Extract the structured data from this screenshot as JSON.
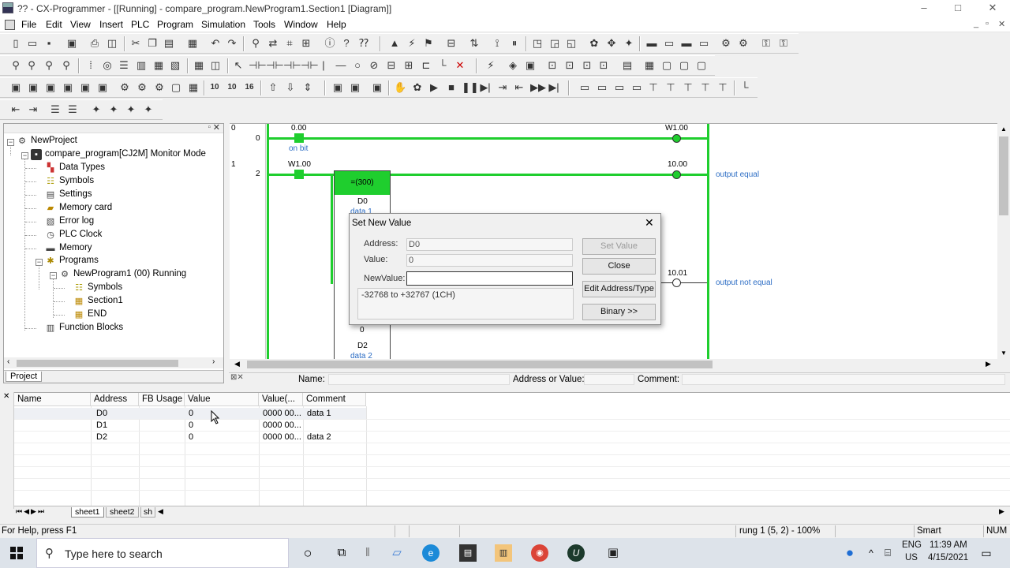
{
  "window": {
    "title": "?? - CX-Programmer - [[Running] - compare_program.NewProgram1.Section1 [Diagram]]",
    "min": "–",
    "max": "□",
    "close": "✕"
  },
  "menu": [
    "File",
    "Edit",
    "View",
    "Insert",
    "PLC",
    "Program",
    "Simulation",
    "Tools",
    "Window",
    "Help"
  ],
  "mdi_buttons": [
    "_",
    "▫",
    "✕"
  ],
  "project_tree": {
    "tab_label": "Project",
    "items": [
      {
        "label": "NewProject",
        "icon": "project-icon"
      },
      {
        "label": "compare_program[CJ2M] Monitor Mode",
        "icon": "plc-icon"
      },
      {
        "label": "Data Types",
        "icon": "data-types-icon"
      },
      {
        "label": "Symbols",
        "icon": "symbols-icon"
      },
      {
        "label": "Settings",
        "icon": "settings-icon"
      },
      {
        "label": "Memory card",
        "icon": "memory-card-icon"
      },
      {
        "label": "Error log",
        "icon": "error-log-icon"
      },
      {
        "label": "PLC Clock",
        "icon": "clock-icon"
      },
      {
        "label": "Memory",
        "icon": "memory-icon"
      },
      {
        "label": "Programs",
        "icon": "programs-icon"
      },
      {
        "label": "NewProgram1 (00) Running",
        "icon": "program-icon"
      },
      {
        "label": "Symbols",
        "icon": "symbols-icon"
      },
      {
        "label": "Section1",
        "icon": "section-icon"
      },
      {
        "label": "END",
        "icon": "section-icon"
      },
      {
        "label": "Function Blocks",
        "icon": "function-blocks-icon"
      }
    ]
  },
  "ladder": {
    "rung0": {
      "number": "0",
      "step": "0",
      "contact_addr": "0.00",
      "contact_comment": "on bit",
      "coil_addr": "W1.00"
    },
    "rung1": {
      "number": "1",
      "step": "2",
      "contact_addr": "W1.00",
      "block_label": "=(300)",
      "operand1": "D0",
      "operand1_comment": "data 1",
      "operand2_value": "0",
      "operand2": "D2",
      "operand2_comment": "data 2",
      "coil1_addr": "10.00",
      "coil1_comment": "output equal",
      "coil2_addr": "10.01",
      "coil2_comment": "output not equal"
    },
    "bottom_bar": {
      "name_label": "Name:",
      "address_label": "Address or Value:",
      "comment_label": "Comment:"
    }
  },
  "dialog": {
    "title": "Set New Value",
    "address_label": "Address:",
    "address_value": "D0",
    "value_label": "Value:",
    "value_value": "0",
    "new_value_label": "NewValue:",
    "new_value": "",
    "range_text": "-32768 to +32767 (1CH)",
    "buttons": {
      "set_value": "Set Value",
      "close": "Close",
      "edit_address": "Edit Address/Type",
      "binary": "Binary >>"
    }
  },
  "watch": {
    "columns": [
      "Name",
      "Address",
      "FB Usage",
      "Value",
      "Value(...",
      "Comment"
    ],
    "rows": [
      [
        "",
        "D0",
        "",
        "0",
        "0000 00...",
        "data 1"
      ],
      [
        "",
        "D1",
        "",
        "0",
        "0000 00...",
        ""
      ],
      [
        "",
        "D2",
        "",
        "0",
        "0000 00...",
        "data 2"
      ]
    ],
    "sheets": [
      "sheet1",
      "sheet2",
      "sh"
    ]
  },
  "statusbar": {
    "help": "For Help, press F1",
    "position": "rung 1 (5, 2)  - 100%",
    "mode": "Smart",
    "num": "NUM"
  },
  "taskbar": {
    "search_placeholder": "Type here to search",
    "lang": "ENG",
    "region": "US",
    "time": "11:39 AM",
    "date": "4/15/2021"
  }
}
